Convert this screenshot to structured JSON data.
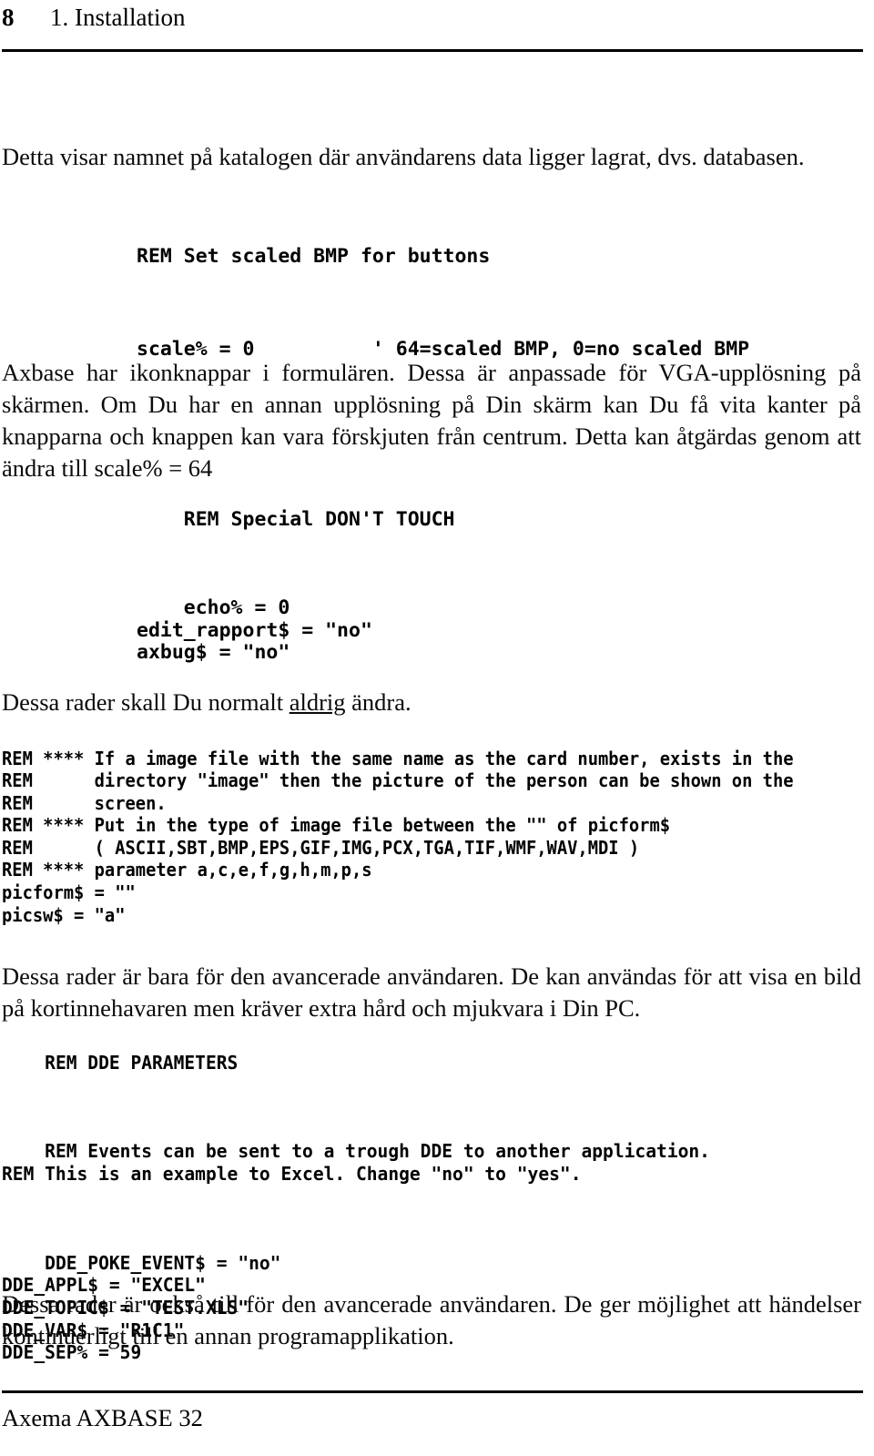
{
  "header": {
    "page_number": "8",
    "chapter_title": "1. Installation"
  },
  "body": {
    "para_intro": "Detta visar namnet på katalogen där användarens data ligger lagrat, dvs. databasen.",
    "para_axbase": "Axbase har ikonknappar i formulären. Dessa är anpassade för VGA-upplösning på skärmen. Om Du har en annan upplösning på Din skärm kan Du få vita kanter på knapparna och knappen kan vara förskjuten från centrum. Detta kan åtgärdas genom att ändra till scale% = 64",
    "para_aldrig_before": "Dessa rader skall Du normalt ",
    "para_aldrig_underlined": "aldrig",
    "para_aldrig_after": " ändra.",
    "para_advanced_1": "Dessa rader är bara för den avancerade användaren. De kan användas för att visa en bild på kortinnehavaren men kräver extra hård och mjukvara i Din PC.",
    "para_advanced_2": "Dessa rader är också till för den avancerade användaren. De ger möjlighet att händelser kontinuerligt till en annan programapplikation."
  },
  "code_blocks": {
    "scale": "REM Set scaled BMP for buttons\n\nscale% = 0          ' 64=scaled BMP, 0=no scaled BMP",
    "special_header": "REM Special DON'T TOUCH",
    "special_lines": "echo% = 0\nedit_rapport$ = \"no\"\naxbug$ = \"no\"",
    "image": "REM **** If a image file with the same name as the card number, exists in the\nREM      directory \"image\" then the picture of the person can be shown on the\nREM      screen.\nREM **** Put in the type of image file between the \"\" of picform$\nREM      ( ASCII,SBT,BMP,EPS,GIF,IMG,PCX,TGA,TIF,WMF,WAV,MDI )\nREM **** parameter a,c,e,f,g,h,m,p,s\npicform$ = \"\"\npicsw$ = \"a\"",
    "dde_header": "REM DDE PARAMETERS",
    "dde_comments": "REM Events can be sent to a trough DDE to another application.\nREM This is an example to Excel. Change \"no\" to \"yes\".",
    "dde_values": "DDE_POKE_EVENT$ = \"no\"\nDDE_APPL$ = \"EXCEL\"\nDDE_TOPIC$ = \"TEST.XLS\"\nDDE_VAR$ = \"R1C1\"\nDDE_SEP% = 59"
  },
  "footer": {
    "text": "Axema AXBASE 32"
  },
  "colors": {
    "text": "#000000",
    "background": "#ffffff",
    "rule": "#000000"
  }
}
